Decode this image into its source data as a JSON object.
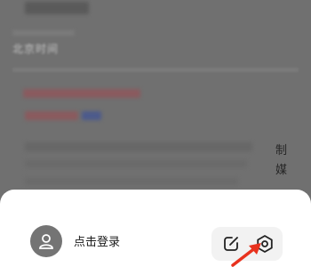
{
  "background": {
    "blurred_label": "北京时间",
    "side_text": [
      "制",
      "媒"
    ]
  },
  "sheet": {
    "login_label": "点击登录",
    "avatar_icon": "user-avatar-icon",
    "edit_icon": "edit-icon",
    "settings_icon": "settings-hexagon-icon"
  },
  "colors": {
    "overlay": "#707070",
    "sheet": "#ffffff",
    "actions_bg": "#f2f2f2",
    "annotation_arrow": "#e8321e"
  }
}
